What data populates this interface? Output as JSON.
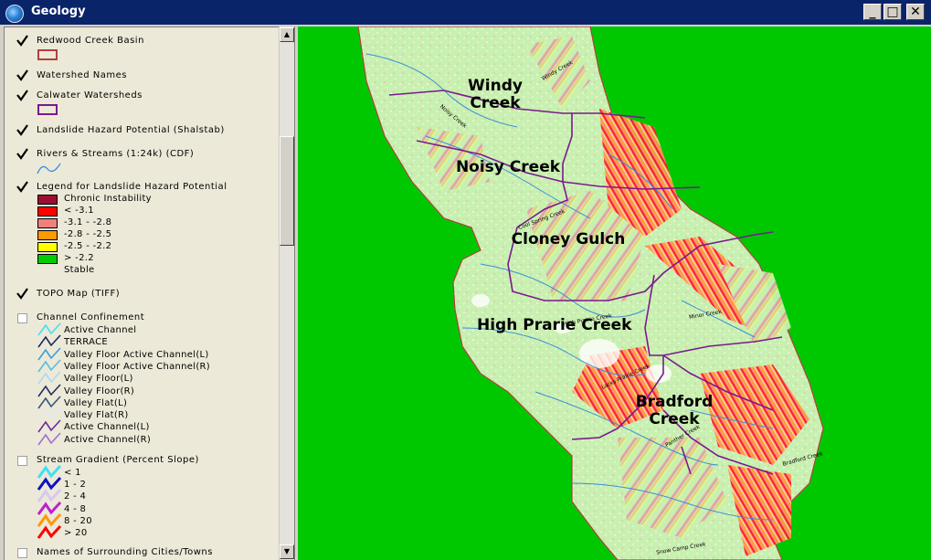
{
  "window": {
    "title": "Geology",
    "icon": "globe-icon",
    "minimize": "_",
    "maximize": "□",
    "close": "✕"
  },
  "colors": {
    "titlebar": "#0a246a",
    "map_background": "#00c800",
    "terrain_green": "#c8f0b0",
    "basin_outline": "#b04040",
    "calwater_outline": "#7a1a8c",
    "stream": "#3a8fd8"
  },
  "toc": {
    "layers": [
      {
        "name": "Redwood Creek Basin",
        "checked": true
      },
      {
        "name": "Watershed Names",
        "checked": true
      },
      {
        "name": "Calwater Watersheds",
        "checked": true
      },
      {
        "name": "Landslide Hazard Potential (Shalstab)",
        "checked": true
      },
      {
        "name": "Rivers & Streams (1:24k) (CDF)",
        "checked": true
      },
      {
        "name": "Legend for Landslide Hazard Potential",
        "checked": true
      },
      {
        "name": "TOPO Map (TIFF)",
        "checked": true
      },
      {
        "name": "Channel Confinement",
        "checked": false
      },
      {
        "name": "Stream Gradient (Percent Slope)",
        "checked": false
      },
      {
        "name": "Names of Surrounding Cities/Towns",
        "checked": false
      }
    ],
    "hazard_legend": [
      {
        "label": "Chronic Instability",
        "color": "#9b1030"
      },
      {
        "label": "<  -3.1",
        "color": "#ff0000"
      },
      {
        "label": "-3.1 - -2.8",
        "color": "#f08080"
      },
      {
        "label": "-2.8 - -2.5",
        "color": "#ff9900"
      },
      {
        "label": "-2.5 - -2.2",
        "color": "#ffff00"
      },
      {
        "label": "> -2.2",
        "color": "#00cc00"
      },
      {
        "label": "Stable",
        "color": ""
      }
    ],
    "confinement_legend": [
      {
        "label": "Active Channel",
        "color": "#40e0f0"
      },
      {
        "label": "TERRACE",
        "color": "#1a2a5a"
      },
      {
        "label": "Valley Floor Active Channel(L)",
        "color": "#3aa0d8"
      },
      {
        "label": "Valley Floor Active Channel(R)",
        "color": "#5abce0"
      },
      {
        "label": "Valley Floor(L)",
        "color": "#b0d8f0"
      },
      {
        "label": "Valley Floor(R)",
        "color": "#203060"
      },
      {
        "label": "Valley Flat(L)",
        "color": "#305878"
      },
      {
        "label": "Valley Flat(R)",
        "color": "#e0e8f0"
      },
      {
        "label": "Active Channel(L)",
        "color": "#6a2a9a"
      },
      {
        "label": "Active Channel(R)",
        "color": "#a070d0"
      }
    ],
    "gradient_legend": [
      {
        "label": "< 1",
        "color": "#40e0f0"
      },
      {
        "label": "1 - 2",
        "color": "#1010c0"
      },
      {
        "label": "2 - 4",
        "color": "#d8c8f0"
      },
      {
        "label": "4 - 8",
        "color": "#c020d0"
      },
      {
        "label": "8 - 20",
        "color": "#ff9900"
      },
      {
        "label": "> 20",
        "color": "#ff0000"
      }
    ]
  },
  "map": {
    "watersheds": [
      {
        "name": "Windy\nCreek"
      },
      {
        "name": "Noisy Creek"
      },
      {
        "name": "Cloney Gulch"
      },
      {
        "name": "High Prarie Creek"
      },
      {
        "name": "Bradford\nCreek"
      }
    ],
    "stream_labels": [
      "Noisy Creek",
      "Windy Creek",
      "Cool Spring Creek",
      "High Prairie Creek",
      "Minor Creek",
      "Lacks Prairie Creek",
      "Bradford Creek",
      "Panther Creek",
      "Snow Camp Creek"
    ]
  }
}
